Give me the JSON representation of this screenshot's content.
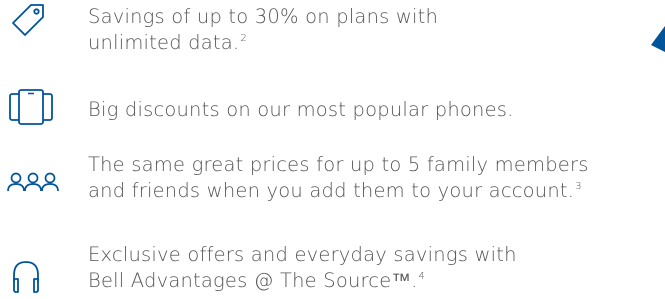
{
  "benefits": [
    {
      "icon": "price-tag-icon",
      "lines": [
        "Savings of up to 30% on plans with",
        "unlimited data."
      ],
      "footnote": "2"
    },
    {
      "icon": "smartphones-icon",
      "lines": [
        "Big discounts on our most popular phones."
      ],
      "footnote": ""
    },
    {
      "icon": "people-group-icon",
      "lines": [
        "The same great prices for up to 5 family members",
        "and friends when you add them to your account."
      ],
      "footnote": "3"
    },
    {
      "icon": "headphones-icon",
      "lines": [
        "Exclusive offers and everyday savings with",
        "Bell Advantages @ The Source™."
      ],
      "footnote": "4"
    }
  ],
  "colors": {
    "icon_stroke": "#00549a",
    "text": "#555555",
    "accent_shape": "#00549a"
  }
}
